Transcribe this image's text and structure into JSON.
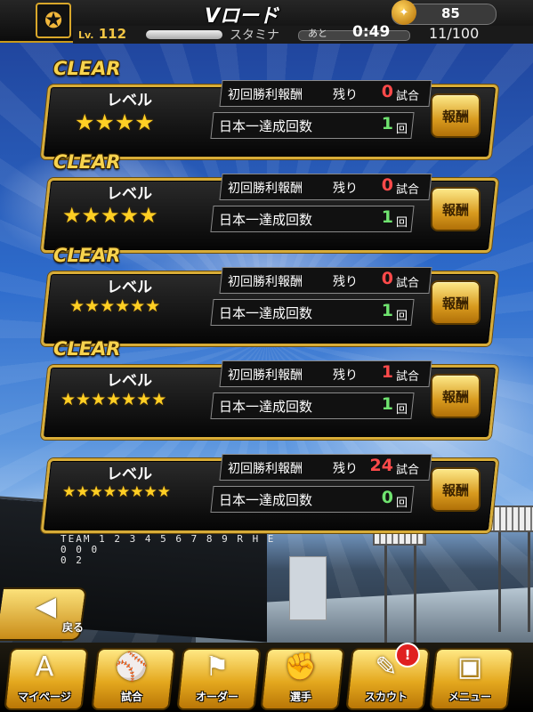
{
  "header": {
    "title": "Vロード",
    "coins": "85",
    "level_prefix": "Lv.",
    "level": "112",
    "stamina_label": "スタミナ",
    "ato_label": "あと",
    "timer": "0:49",
    "count": "11/100"
  },
  "cards": [
    {
      "clear": "CLEAR",
      "level_label": "レベル",
      "stars": "★★★★",
      "first_win_label": "初回勝利報酬",
      "remain_label": "残り",
      "remain_value": "0",
      "remain_unit": "試合",
      "japan_label": "日本一達成回数",
      "japan_value": "1",
      "japan_unit": "回",
      "reward_label": "報酬"
    },
    {
      "clear": "CLEAR",
      "level_label": "レベル",
      "stars": "★★★★★",
      "first_win_label": "初回勝利報酬",
      "remain_label": "残り",
      "remain_value": "0",
      "remain_unit": "試合",
      "japan_label": "日本一達成回数",
      "japan_value": "1",
      "japan_unit": "回",
      "reward_label": "報酬"
    },
    {
      "clear": "CLEAR",
      "level_label": "レベル",
      "stars": "★★★★★★",
      "first_win_label": "初回勝利報酬",
      "remain_label": "残り",
      "remain_value": "0",
      "remain_unit": "試合",
      "japan_label": "日本一達成回数",
      "japan_value": "1",
      "japan_unit": "回",
      "reward_label": "報酬"
    },
    {
      "clear": "CLEAR",
      "level_label": "レベル",
      "stars": "★★★★★★★",
      "first_win_label": "初回勝利報酬",
      "remain_label": "残り",
      "remain_value": "1",
      "remain_unit": "試合",
      "japan_label": "日本一達成回数",
      "japan_value": "1",
      "japan_unit": "回",
      "reward_label": "報酬"
    },
    {
      "clear": "",
      "level_label": "レベル",
      "stars": "★★★★★★★★",
      "first_win_label": "初回勝利報酬",
      "remain_label": "残り",
      "remain_value": "24",
      "remain_unit": "試合",
      "japan_label": "日本一達成回数",
      "japan_value": "0",
      "japan_unit": "回",
      "reward_label": "報酬"
    }
  ],
  "scoreboard": {
    "line1": "TEAM 1 2 3 4 5 6 7 8 9 R H E",
    "line2": "0 0 0",
    "line3": "0 2"
  },
  "back_label": "戻る",
  "nav": [
    {
      "label": "マイページ",
      "icon": "A"
    },
    {
      "label": "試合",
      "icon": "⚾"
    },
    {
      "label": "オーダー",
      "icon": "⚑"
    },
    {
      "label": "選手",
      "icon": "✊"
    },
    {
      "label": "スカウト",
      "icon": "✎"
    },
    {
      "label": "メニュー",
      "icon": "▣"
    }
  ],
  "notify_badge": "!"
}
